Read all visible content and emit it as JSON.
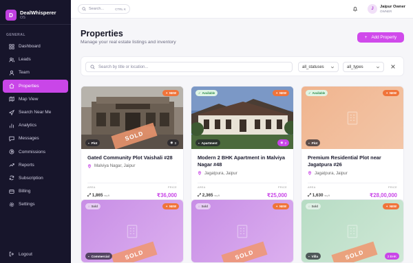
{
  "brand": {
    "initial": "D",
    "name": "DealWhisperer",
    "sub": "OS"
  },
  "sidebar": {
    "section": "GENERAL",
    "items": [
      {
        "label": "Dashboard",
        "icon": "grid-icon"
      },
      {
        "label": "Leads",
        "icon": "users-icon"
      },
      {
        "label": "Team",
        "icon": "team-icon"
      },
      {
        "label": "Properties",
        "icon": "home-icon",
        "active": true
      },
      {
        "label": "Map View",
        "icon": "map-icon"
      },
      {
        "label": "Search Near Me",
        "icon": "location-icon"
      },
      {
        "label": "Analytics",
        "icon": "bar-chart-icon"
      },
      {
        "label": "Messages",
        "icon": "message-icon"
      },
      {
        "label": "Commissions",
        "icon": "coins-icon"
      },
      {
        "label": "Reports",
        "icon": "trend-icon"
      },
      {
        "label": "Subscription",
        "icon": "refresh-icon"
      },
      {
        "label": "Billing",
        "icon": "card-icon"
      },
      {
        "label": "Settings",
        "icon": "gear-icon"
      }
    ],
    "logout": "Logout"
  },
  "topbar": {
    "search_placeholder": "Search...",
    "shortcut": "CTRL K",
    "user_initial": "J",
    "user_name": "Jaipur Owner",
    "user_role": "OWNER"
  },
  "page": {
    "title": "Properties",
    "subtitle": "Manage your real estate listings and inventory",
    "add_button": "Add Property"
  },
  "filters": {
    "search_placeholder": "Search by title or location...",
    "status": "all_statuses",
    "type": "all_types"
  },
  "colors": {
    "accent": "#c946e8",
    "sidebar": "#17152b",
    "new_badge": "#f0743a",
    "price": "#c946e8"
  },
  "labels": {
    "area": "AREA",
    "price": "PRICE",
    "unit": "sq.ft",
    "sold": "SOLD",
    "new": "NEW"
  },
  "cards": [
    {
      "status": "",
      "new": true,
      "sold": true,
      "type": "Plot",
      "photos": "3",
      "title": "Gated Community Plot Vaishali #28",
      "location": "Malviya Nagar, Jaipur",
      "area": "1,865",
      "price": "₹36,000"
    },
    {
      "status": "Available",
      "new": true,
      "sold": false,
      "type": "Apartment",
      "photos": "2",
      "title": "Modern 2 BHK Apartment in Malviya Nagar #48",
      "location": "Jagatpura, Jaipur",
      "area": "2,365",
      "price": "₹25,000"
    },
    {
      "status": "Available",
      "new": true,
      "sold": false,
      "type": "Plot",
      "photos": "",
      "title": "Premium Residential Plot near Jagatpura #26",
      "location": "Jagatpura, Jaipur",
      "area": "1,630",
      "price": "₹28,00,000"
    },
    {
      "status": "Sold",
      "new": true,
      "sold": true,
      "type": "Commercial",
      "photos": "",
      "title": "",
      "location": "",
      "area": "",
      "price": ""
    },
    {
      "status": "Sold",
      "new": true,
      "sold": true,
      "type": "",
      "photos": "",
      "title": "",
      "location": "",
      "area": "",
      "price": ""
    },
    {
      "status": "Sold",
      "new": true,
      "sold": true,
      "type": "Villa",
      "photos": "2 BHK",
      "title": "",
      "location": "",
      "area": "",
      "price": ""
    }
  ]
}
